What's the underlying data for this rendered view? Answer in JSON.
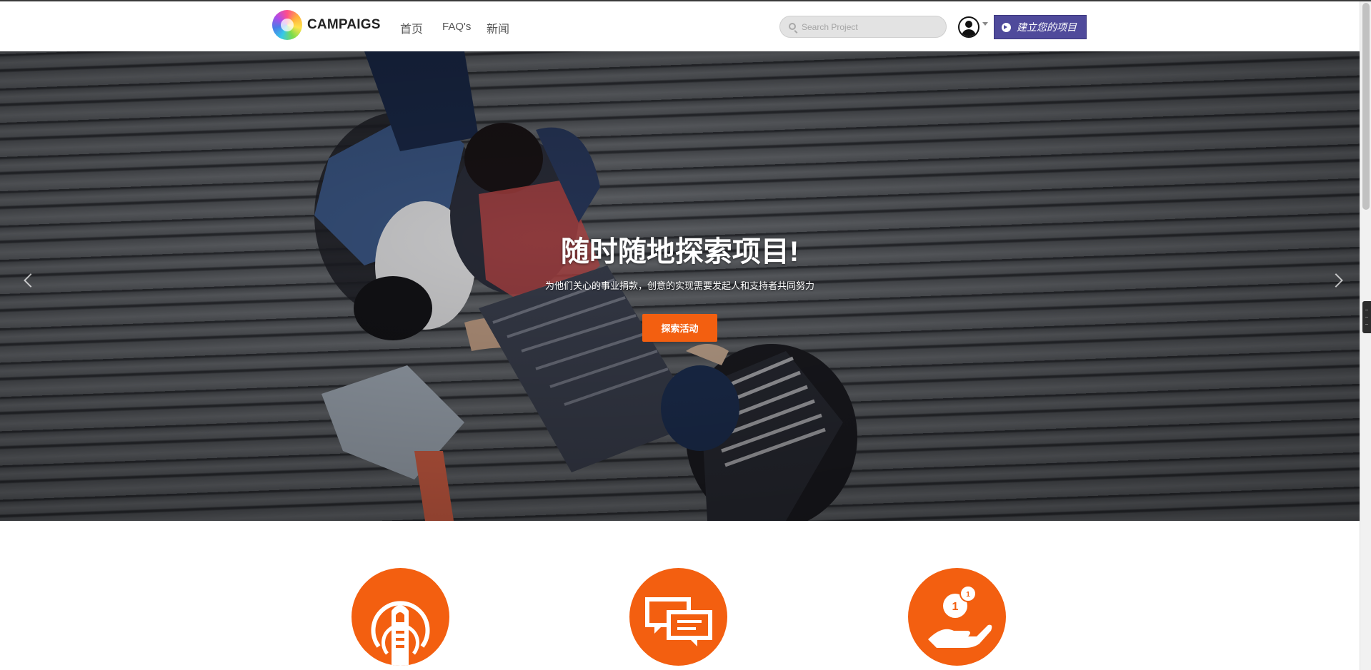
{
  "header": {
    "brand": "CAMPAIGS",
    "nav": {
      "home": "首页",
      "faq": "FAQ's",
      "news": "新闻"
    },
    "search": {
      "placeholder": "Search Project",
      "value": ""
    },
    "cta_label": "建立您的项目"
  },
  "hero": {
    "title": "随时随地探索项目!",
    "subtitle": "为他们关心的事业捐款，创意的实现需要发起人和支持者共同努力",
    "button_label": "探索活动"
  },
  "features": [
    {
      "icon": "tap-finger-icon"
    },
    {
      "icon": "chat-bubbles-icon"
    },
    {
      "icon": "hand-coin-icon"
    }
  ],
  "colors": {
    "accent": "#f35f10",
    "cta": "#4f4a9b",
    "header_bg": "#ffffff"
  }
}
